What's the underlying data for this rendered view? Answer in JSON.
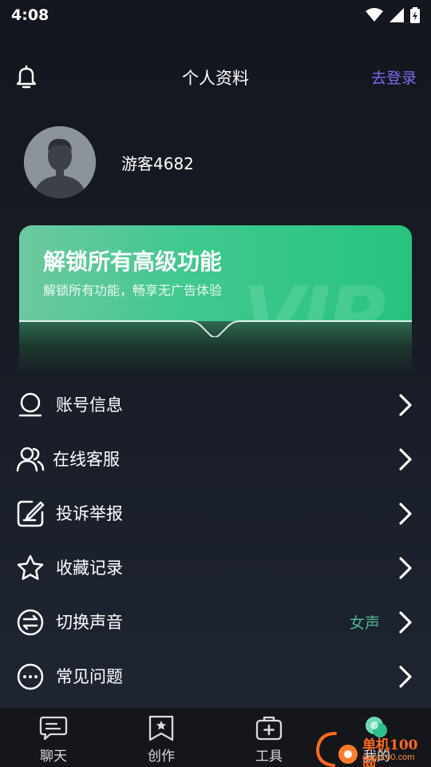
{
  "status": {
    "time": "4:08"
  },
  "header": {
    "title": "个人资料",
    "login_label": "去登录"
  },
  "profile": {
    "username": "游客4682"
  },
  "vip": {
    "title": "解锁所有高级功能",
    "subtitle": "解锁所有功能，畅享无广告体验",
    "watermark": "VIP"
  },
  "menu": [
    {
      "label": "账号信息",
      "icon": "user-icon"
    },
    {
      "label": "在线客服",
      "icon": "users-icon"
    },
    {
      "label": "投诉举报",
      "icon": "edit-icon"
    },
    {
      "label": "收藏记录",
      "icon": "star-icon"
    },
    {
      "label": "切换声音",
      "icon": "swap-icon",
      "value": "女声"
    },
    {
      "label": "常见问题",
      "icon": "more-icon"
    }
  ],
  "tabs": [
    {
      "label": "聊天",
      "icon": "chat-icon"
    },
    {
      "label": "创作",
      "icon": "bookmark-icon"
    },
    {
      "label": "工具",
      "icon": "toolbox-icon"
    },
    {
      "label": "我的",
      "icon": "profile-icon"
    }
  ],
  "watermark": {
    "brand": "单机100网",
    "url": "danji100.com"
  },
  "colors": {
    "accent": "#7b6cf2",
    "vip_green": "#3fc890",
    "value_green": "#4fb890"
  }
}
